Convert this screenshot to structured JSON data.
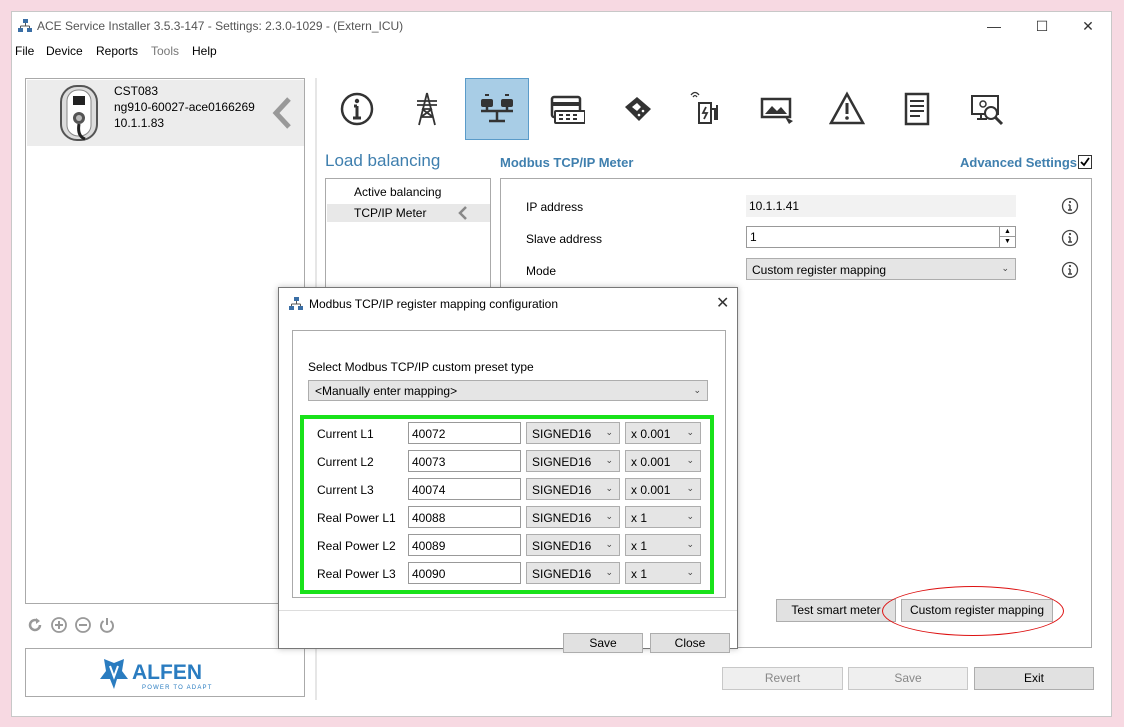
{
  "window": {
    "title": "ACE Service Installer 3.5.3-147 - Settings: 2.3.0-1029 -  (Extern_ICU)",
    "minimize": "—",
    "maximize": "☐",
    "close": "✕"
  },
  "menu": [
    "File",
    "Device",
    "Reports",
    "Tools",
    "Help"
  ],
  "device": {
    "name": "CST083",
    "serial": "ng910-60027-ace0166269",
    "ip": "10.1.1.83"
  },
  "logo": {
    "text": "ALFEN",
    "tagline": "POWER TO ADAPT",
    "color": "#2a7cc0"
  },
  "nav_icons": [
    "info-icon",
    "pylon-icon",
    "load-balancing-icon",
    "card-reader-icon",
    "payment-terminal-icon",
    "ev-charger-icon",
    "display-icon",
    "warning-icon",
    "document-icon",
    "diagnostics-icon"
  ],
  "section": {
    "title": "Load balancing",
    "subtitle": "Modbus TCP/IP Meter",
    "advanced_label": "Advanced Settings",
    "advanced_checked": true
  },
  "subnav": [
    "Active balancing",
    "TCP/IP Meter"
  ],
  "fields": {
    "ip_label": "IP address",
    "ip_value": "10.1.1.41",
    "slave_label": "Slave address",
    "slave_value": "1",
    "mode_label": "Mode",
    "mode_value": "Custom register mapping"
  },
  "buttons": {
    "test_meter": "Test smart meter",
    "custom_mapping": "Custom register mapping",
    "revert": "Revert",
    "save": "Save",
    "exit": "Exit"
  },
  "dialog": {
    "title": "Modbus TCP/IP register mapping configuration",
    "close": "✕",
    "preset_label": "Select Modbus TCP/IP custom preset type",
    "preset_value": "<Manually enter mapping>",
    "rows": [
      {
        "label": "Current L1",
        "register": "40072",
        "type": "SIGNED16",
        "scale": "x 0.001"
      },
      {
        "label": "Current L2",
        "register": "40073",
        "type": "SIGNED16",
        "scale": "x 0.001"
      },
      {
        "label": "Current L3",
        "register": "40074",
        "type": "SIGNED16",
        "scale": "x 0.001"
      },
      {
        "label": "Real Power L1",
        "register": "40088",
        "type": "SIGNED16",
        "scale": "x 1"
      },
      {
        "label": "Real Power L2",
        "register": "40089",
        "type": "SIGNED16",
        "scale": "x 1"
      },
      {
        "label": "Real Power L3",
        "register": "40090",
        "type": "SIGNED16",
        "scale": "x 1"
      }
    ],
    "save": "Save",
    "close_button": "Close"
  },
  "colors": {
    "accent": "#3f7fae",
    "highlight": "#19e21a",
    "annotation": "#dd1111"
  }
}
